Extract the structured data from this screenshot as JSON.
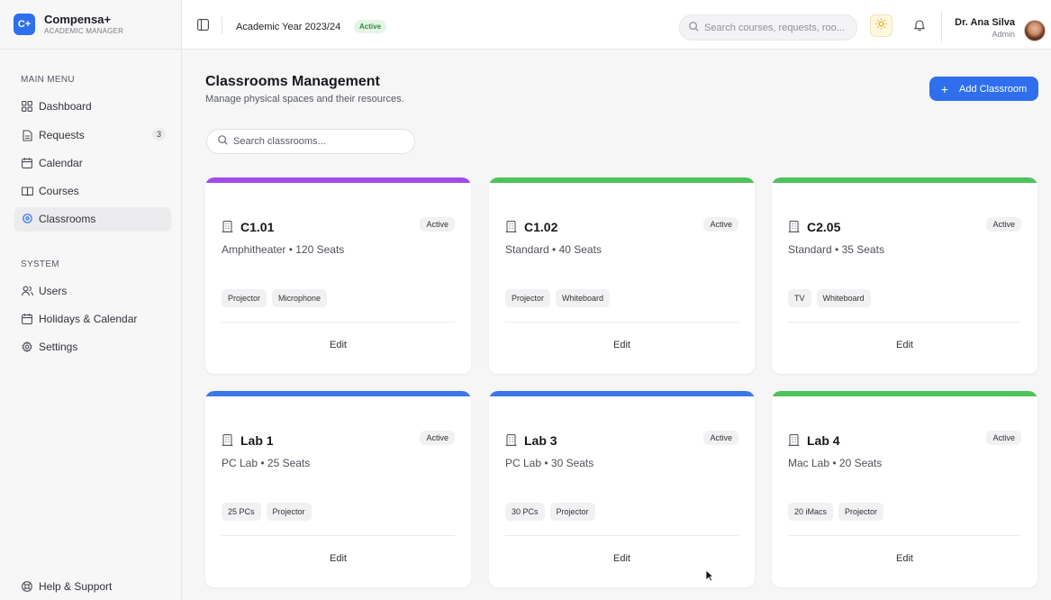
{
  "brand": {
    "logo": "C+",
    "name": "Compensa+",
    "subtitle": "ACADEMIC MANAGER"
  },
  "sidebar": {
    "main_title": "MAIN MENU",
    "main_items": [
      {
        "label": "Dashboard",
        "icon": "dashboard-icon"
      },
      {
        "label": "Requests",
        "icon": "document-icon",
        "badge": "3"
      },
      {
        "label": "Calendar",
        "icon": "calendar-icon"
      },
      {
        "label": "Courses",
        "icon": "book-icon"
      },
      {
        "label": "Classrooms",
        "icon": "location-pin-icon",
        "active": true
      }
    ],
    "system_title": "SYSTEM",
    "system_items": [
      {
        "label": "Users",
        "icon": "users-icon"
      },
      {
        "label": "Holidays & Calendar",
        "icon": "calendar-icon"
      },
      {
        "label": "Settings",
        "icon": "gear-icon"
      }
    ],
    "help": {
      "label": "Help & Support",
      "icon": "lifebuoy-icon"
    }
  },
  "header": {
    "academic_year": "Academic Year 2023/24",
    "year_status": "Active",
    "search_placeholder": "Search courses, requests, roo...",
    "user_name": "Dr. Ana Silva",
    "user_role": "Admin"
  },
  "main": {
    "title": "Classrooms Management",
    "subtitle": "Manage physical spaces and their resources.",
    "add_button": "Add Classroom",
    "search_placeholder": "Search classrooms..."
  },
  "cards": [
    {
      "name": "C1.01",
      "status": "Active",
      "meta": "Amphitheater • 120 Seats",
      "tags": [
        "Projector",
        "Microphone"
      ],
      "edit": "Edit",
      "color": "#a14bea"
    },
    {
      "name": "C1.02",
      "status": "Active",
      "meta": "Standard • 40 Seats",
      "tags": [
        "Projector",
        "Whiteboard"
      ],
      "edit": "Edit",
      "color": "#4ec35a"
    },
    {
      "name": "C2.05",
      "status": "Active",
      "meta": "Standard • 35 Seats",
      "tags": [
        "TV",
        "Whiteboard"
      ],
      "edit": "Edit",
      "color": "#4ec35a"
    },
    {
      "name": "Lab 1",
      "status": "Active",
      "meta": "PC Lab • 25 Seats",
      "tags": [
        "25 PCs",
        "Projector"
      ],
      "edit": "Edit",
      "color": "#3b78e7"
    },
    {
      "name": "Lab 3",
      "status": "Active",
      "meta": "PC Lab • 30 Seats",
      "tags": [
        "30 PCs",
        "Projector"
      ],
      "edit": "Edit",
      "color": "#3b78e7"
    },
    {
      "name": "Lab 4",
      "status": "Active",
      "meta": "Mac Lab • 20 Seats",
      "tags": [
        "20 iMacs",
        "Projector"
      ],
      "edit": "Edit",
      "color": "#4ec35a"
    }
  ],
  "colors": {
    "accent": "#2f6fed",
    "active_green": "#2e8b43"
  }
}
